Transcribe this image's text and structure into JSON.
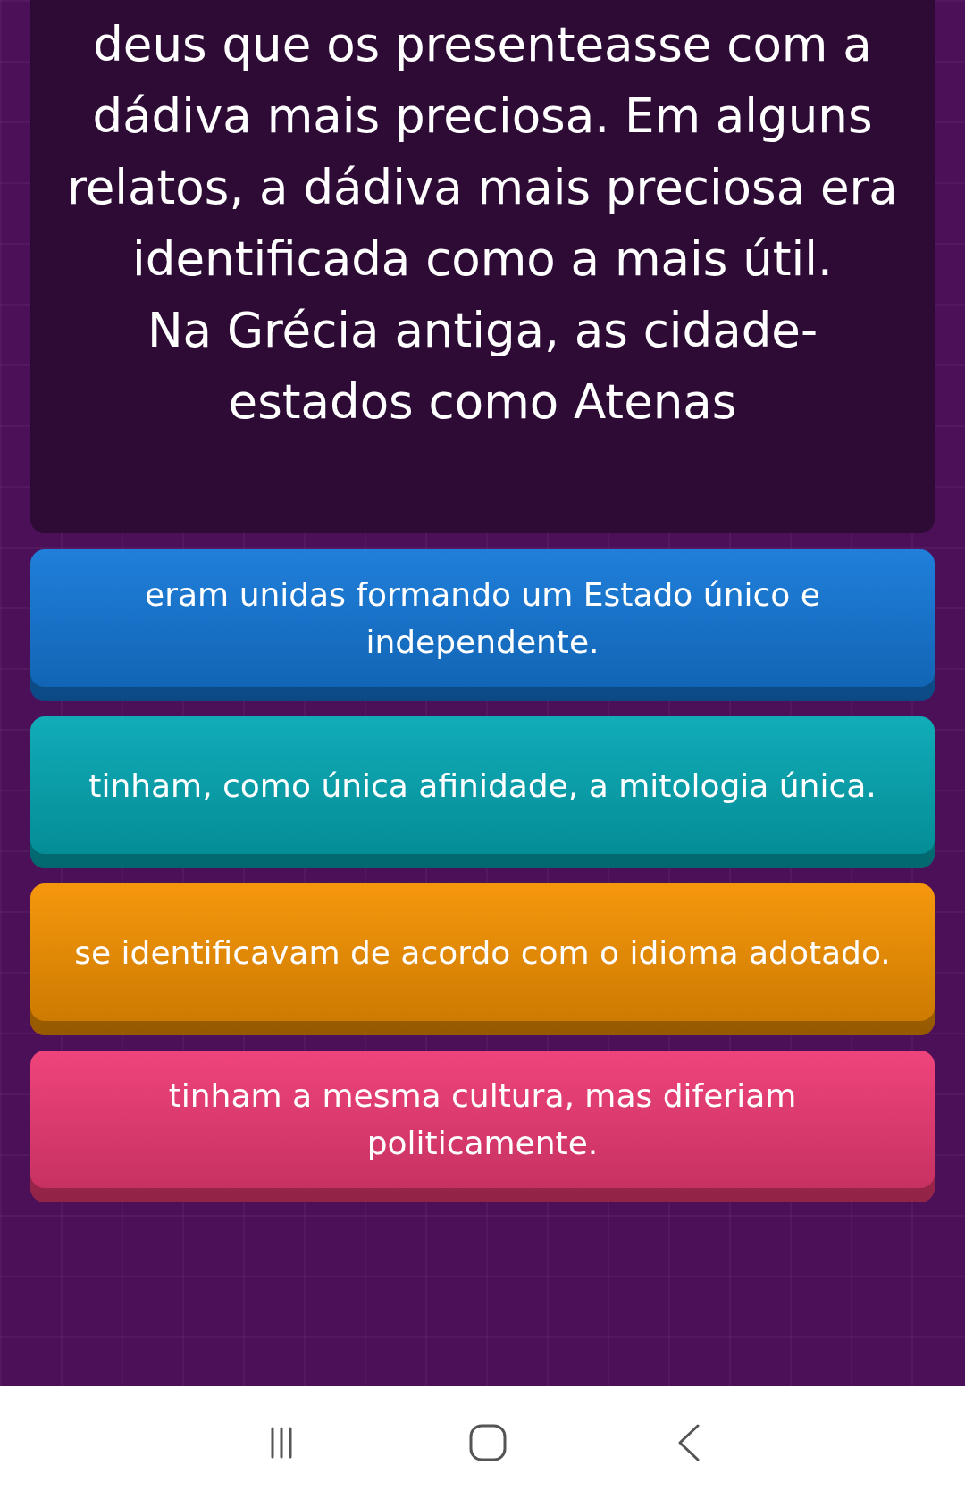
{
  "question": {
    "paragraphs": [
      "deus que os presenteasse com a dádiva mais preciosa. Em alguns relatos, a dádiva mais preciosa era identificada como a mais útil.",
      "Na Grécia antiga, as cidade-estados como Atenas"
    ]
  },
  "answers": [
    {
      "text": "eram unidas formando um Estado único e independente.",
      "color": "#1478d8"
    },
    {
      "text": "tinham, como única afinidade, a mitologia única.",
      "color": "#04a8b4"
    },
    {
      "text": "se identificavam de acordo com o idioma adotado.",
      "color": "#f59200"
    },
    {
      "text": "tinham a mesma cultura, mas diferiam politicamente.",
      "color": "#ee3a74"
    }
  ]
}
